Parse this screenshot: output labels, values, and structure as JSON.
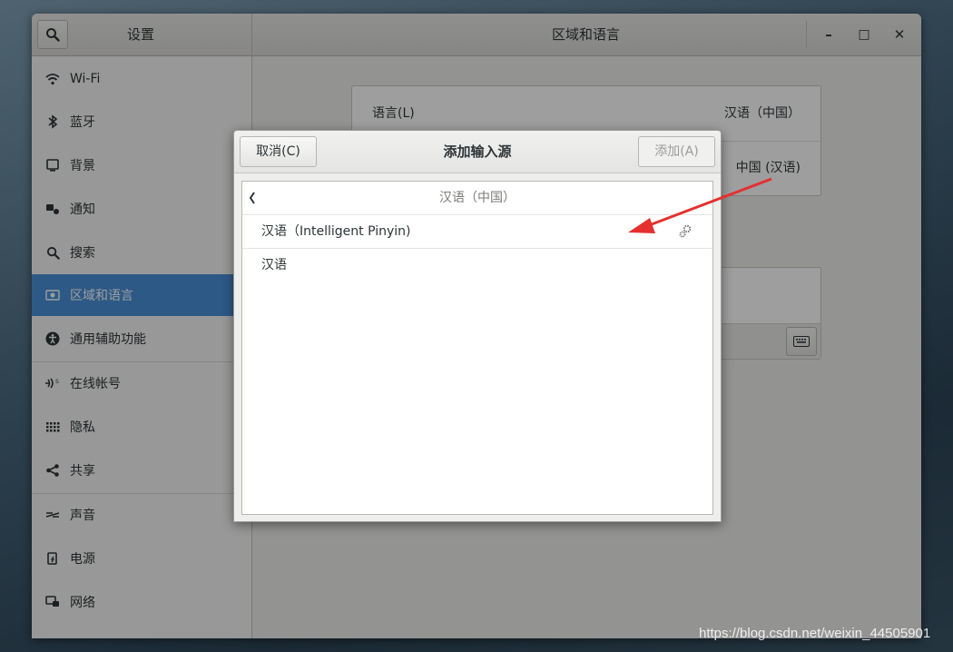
{
  "window": {
    "sidebar_title": "设置",
    "main_title": "区域和语言",
    "controls": {
      "minimize": "–",
      "maximize": "□",
      "close": "✕"
    }
  },
  "sidebar": {
    "items": [
      {
        "label": "Wi-Fi",
        "icon": "wifi-icon"
      },
      {
        "label": "蓝牙",
        "icon": "bluetooth-icon"
      },
      {
        "label": "背景",
        "icon": "background-icon"
      },
      {
        "label": "通知",
        "icon": "notification-icon"
      },
      {
        "label": "搜索",
        "icon": "search-icon"
      },
      {
        "label": "区域和语言",
        "icon": "region-icon",
        "active": true
      },
      {
        "label": "通用辅助功能",
        "icon": "accessibility-icon"
      },
      {
        "label": "在线帐号",
        "icon": "online-accounts-icon"
      },
      {
        "label": "隐私",
        "icon": "privacy-icon"
      },
      {
        "label": "共享",
        "icon": "share-icon"
      },
      {
        "label": "声音",
        "icon": "sound-icon"
      },
      {
        "label": "电源",
        "icon": "power-icon"
      },
      {
        "label": "网络",
        "icon": "network-icon"
      }
    ]
  },
  "main": {
    "language_label": "语言(L)",
    "language_value": "汉语（中国）",
    "formats_value": "中国 (汉语)"
  },
  "dialog": {
    "cancel_label": "取消(C)",
    "title": "添加输入源",
    "add_label": "添加(A)",
    "list_header": "汉语（中国）",
    "items": [
      {
        "label": "汉语（Intelligent Pinyin)"
      },
      {
        "label": "汉语"
      }
    ]
  },
  "watermark": "https://blog.csdn.net/weixin_44505901",
  "colors": {
    "accent": "#4a90d9",
    "annotation_arrow": "#e53030"
  }
}
